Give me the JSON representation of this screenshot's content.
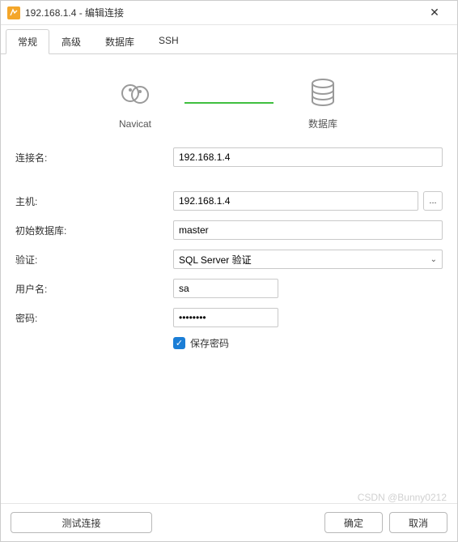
{
  "window": {
    "title": "192.168.1.4 - 编辑连接",
    "close": "✕"
  },
  "tabs": {
    "general": "常规",
    "advanced": "高级",
    "database": "数据库",
    "ssh": "SSH"
  },
  "diagram": {
    "left_label": "Navicat",
    "right_label": "数据库"
  },
  "form": {
    "conn_name_label": "连接名:",
    "conn_name_value": "192.168.1.4",
    "host_label": "主机:",
    "host_value": "192.168.1.4",
    "host_more": "...",
    "initdb_label": "初始数据库:",
    "initdb_value": "master",
    "auth_label": "验证:",
    "auth_value": "SQL Server 验证",
    "user_label": "用户名:",
    "user_value": "sa",
    "pass_label": "密码:",
    "pass_value": "••••••••",
    "save_pass_label": "保存密码"
  },
  "footer": {
    "test": "测试连接",
    "ok": "确定",
    "cancel": "取消"
  },
  "watermark": "CSDN @Bunny0212"
}
